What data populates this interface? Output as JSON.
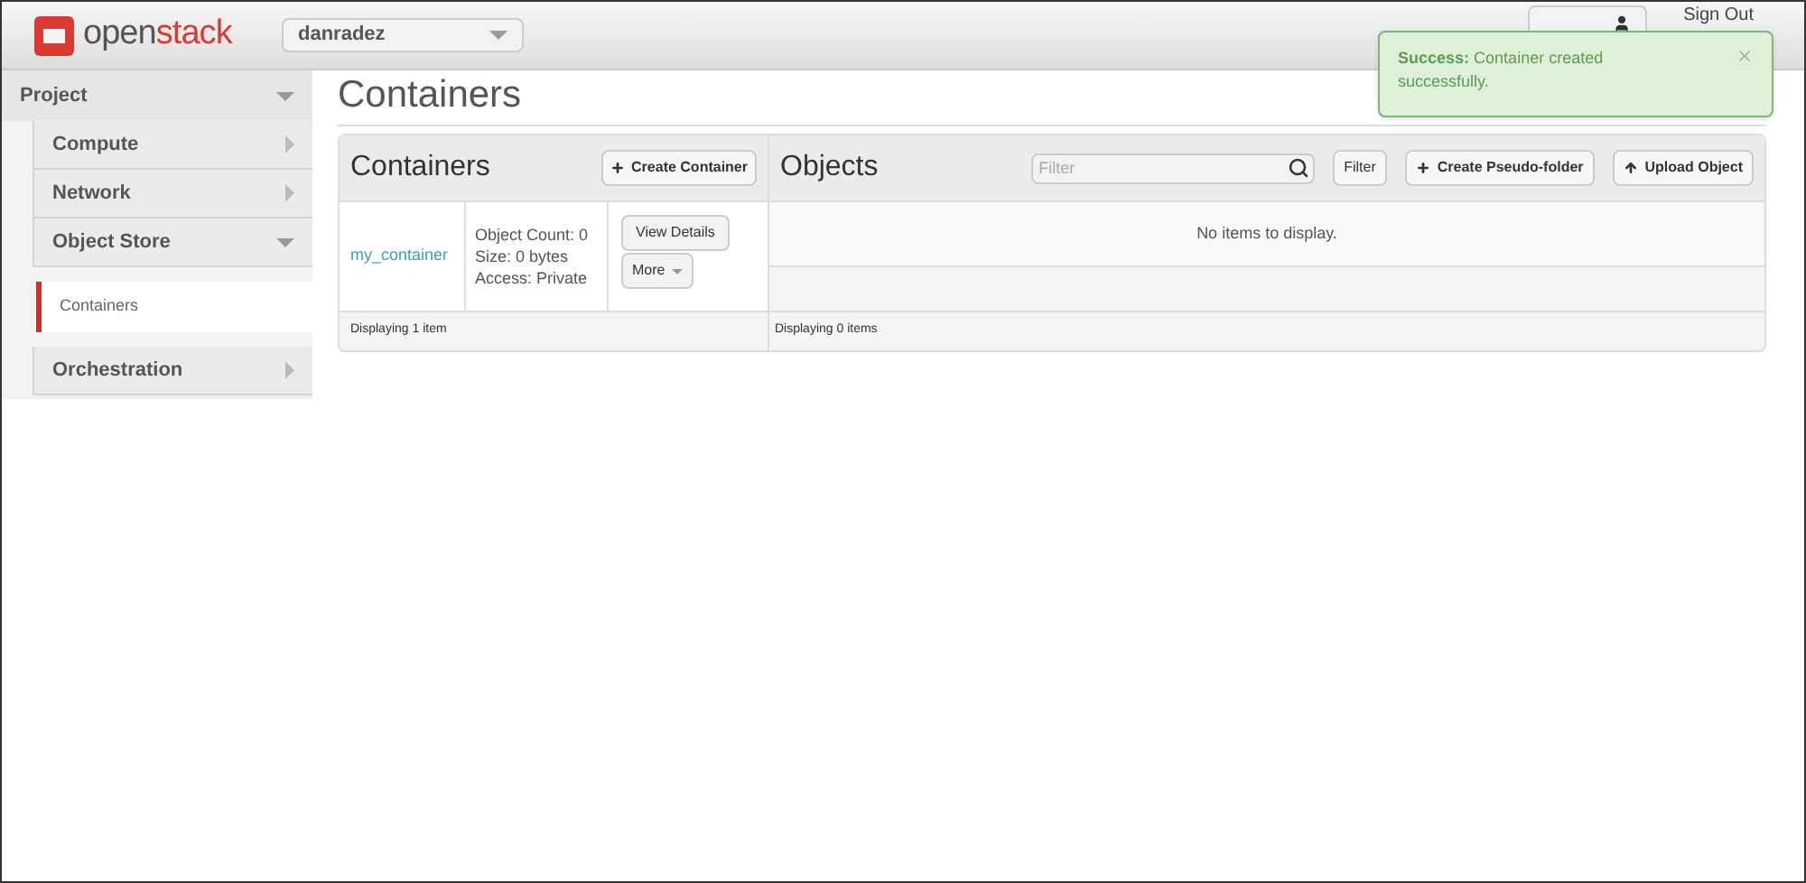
{
  "header": {
    "logo": {
      "prefix": "open",
      "suffix": "stack"
    },
    "project_selector": "danradez",
    "user_menu": {
      "kind": "user"
    },
    "sign_out": "Sign Out"
  },
  "sidebar": {
    "section": {
      "label": "Project",
      "expanded": true
    },
    "items": [
      {
        "label": "Compute",
        "expanded": false
      },
      {
        "label": "Network",
        "expanded": false
      },
      {
        "label": "Object Store",
        "expanded": true,
        "children": [
          {
            "label": "Containers",
            "selected": true
          }
        ]
      },
      {
        "label": "Orchestration",
        "expanded": false
      }
    ]
  },
  "page_title": "Containers",
  "containers": {
    "title": "Containers",
    "create_button": "Create Container",
    "rows": [
      {
        "name": "my_container",
        "details": [
          "Object Count: 0",
          "Size: 0 bytes",
          "Access: Private"
        ],
        "actions": [
          "View Details",
          "More"
        ]
      }
    ],
    "footer": "Displaying 1 item"
  },
  "objects": {
    "title": "Objects",
    "filter": {
      "placeholder": "Filter"
    },
    "filter_button": "Filter",
    "create_folder_button": "Create Pseudo-folder",
    "upload_button": "Upload Object",
    "empty_message": "No items to display.",
    "footer": "Displaying 0 items"
  },
  "toast": {
    "title": "Success:",
    "message": "Container created successfully."
  }
}
